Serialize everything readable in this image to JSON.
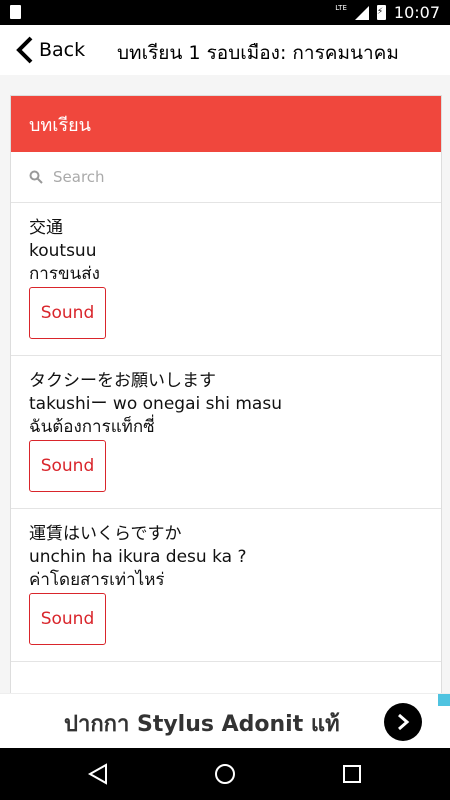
{
  "status_bar": {
    "time": "10:07",
    "network": "LTE"
  },
  "app_bar": {
    "back_label": "Back",
    "title": "บทเรียน 1 รอบเมือง: การคมนาคม"
  },
  "card": {
    "header": "บทเรียน"
  },
  "search": {
    "placeholder": "Search"
  },
  "items": [
    {
      "japanese": "交通",
      "romaji": "koutsuu",
      "thai": "การขนส่ง",
      "button": "Sound"
    },
    {
      "japanese": "タクシーをお願いします",
      "romaji": "takushiー wo onegai shi masu",
      "thai": "ฉันต้องการแท็กซี่",
      "button": "Sound"
    },
    {
      "japanese": "運賃はいくらですか",
      "romaji": "unchin ha ikura desu ka ?",
      "thai": "ค่าโดยสารเท่าไหร่",
      "button": "Sound"
    }
  ],
  "ad": {
    "text": "ปากกา Stylus Adonit แท้"
  },
  "icons": {
    "back": "chevron-left-icon",
    "search": "search-icon",
    "ad_arrow": "chevron-right-icon"
  },
  "colors": {
    "accent": "#f0473d",
    "button": "#d9252b"
  }
}
